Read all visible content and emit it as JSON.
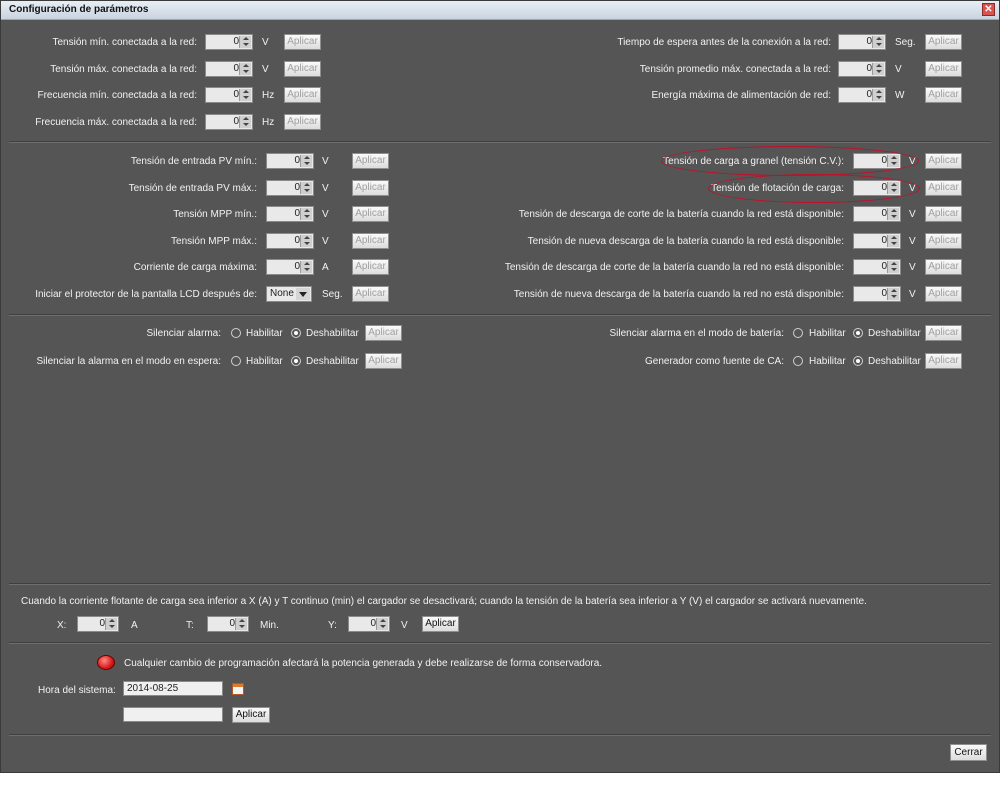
{
  "window": {
    "title": "Configuración de parámetros",
    "close_symbol": "✕"
  },
  "apply_label": "Aplicar",
  "grid": {
    "rows": [
      {
        "label": "Tensión mín. conectada a la red:",
        "value": "0",
        "unit": "V"
      },
      {
        "label": "Tensión máx. conectada a la red:",
        "value": "0",
        "unit": "V"
      },
      {
        "label": "Frecuencia mín. conectada a la red:",
        "value": "0",
        "unit": "Hz"
      },
      {
        "label": "Frecuencia máx. conectada a la red:",
        "value": "0",
        "unit": "Hz"
      }
    ],
    "rows_right": [
      {
        "label": "Tiempo de espera antes de la conexión a la red:",
        "value": "0",
        "unit": "Seg."
      },
      {
        "label": "Tensión promedio máx. conectada a la red:",
        "value": "0",
        "unit": "V"
      },
      {
        "label": "Energía máxima de alimentación de red:",
        "value": "0",
        "unit": "W"
      }
    ]
  },
  "pv": {
    "rows": [
      {
        "label": "Tensión de entrada PV mín.:",
        "value": "0",
        "unit": "V"
      },
      {
        "label": "Tensión de entrada PV máx.:",
        "value": "0",
        "unit": "V"
      },
      {
        "label": "Tensión MPP mín.:",
        "value": "0",
        "unit": "V"
      },
      {
        "label": "Tensión MPP máx.:",
        "value": "0",
        "unit": "V"
      },
      {
        "label": "Corriente de carga máxima:",
        "value": "0",
        "unit": "A"
      }
    ],
    "lcd": {
      "label": "Iniciar el protector de la pantalla LCD después de:",
      "value": "None",
      "unit": "Seg."
    },
    "rows_right": [
      {
        "label": "Tensión de carga a granel (tensión C.V.):",
        "value": "0",
        "unit": "V"
      },
      {
        "label": "Tensión de flotación de carga:",
        "value": "0",
        "unit": "V"
      },
      {
        "label": "Tensión de descarga de corte de la batería cuando la red está disponible:",
        "value": "0",
        "unit": "V"
      },
      {
        "label": "Tensión de nueva descarga de la batería cuando la red está disponible:",
        "value": "0",
        "unit": "V"
      },
      {
        "label": "Tensión de descarga de corte de la batería cuando la red no está disponible:",
        "value": "0",
        "unit": "V"
      },
      {
        "label": "Tensión de nueva descarga de la batería cuando la red no está disponible:",
        "value": "0",
        "unit": "V"
      }
    ]
  },
  "options": {
    "enable": "Habilitar",
    "disable": "Deshabilitar",
    "items": [
      {
        "label": "Silenciar alarma:",
        "selected": "disable"
      },
      {
        "label": "Silenciar la alarma en el modo en espera:",
        "selected": "disable"
      },
      {
        "label": "Silenciar alarma en el modo de batería:",
        "selected": "disable"
      },
      {
        "label": "Generador como fuente de CA:",
        "selected": "disable"
      }
    ]
  },
  "charger": {
    "description": "Cuando la corriente flotante de carga sea inferior a X (A) y T continuo (min) el cargador se desactivará; cuando la tensión de la batería sea inferior a Y (V) el cargador se activará nuevamente.",
    "x": {
      "label": "X:",
      "value": "0",
      "unit": "A"
    },
    "t": {
      "label": "T:",
      "value": "0",
      "unit": "Min."
    },
    "y": {
      "label": "Y:",
      "value": "0",
      "unit": "V"
    }
  },
  "warning": "Cualquier cambio de programación afectará la potencia generada y debe realizarse de forma conservadora.",
  "system_time": {
    "label": "Hora del sistema:",
    "date": "2014-08-25",
    "time": ""
  },
  "close_label": "Cerrar"
}
